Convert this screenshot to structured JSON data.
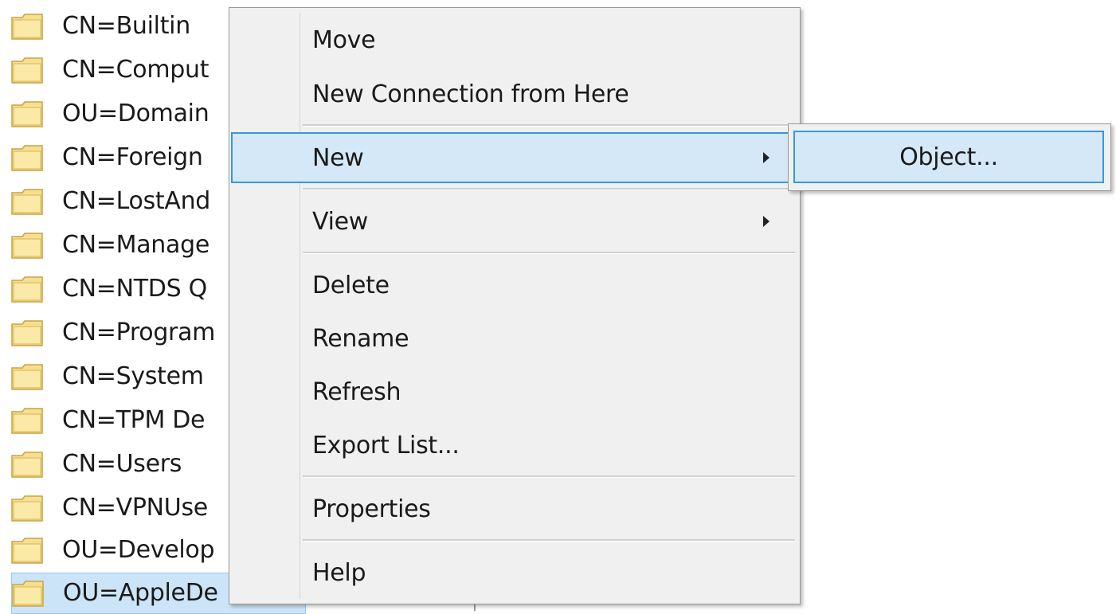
{
  "tree": {
    "items": [
      {
        "label": "CN=Builtin",
        "icon": "folder-icon"
      },
      {
        "label": "CN=Comput",
        "icon": "folder-icon"
      },
      {
        "label": "OU=Domain",
        "icon": "folder-icon"
      },
      {
        "label": "CN=Foreign",
        "icon": "folder-icon"
      },
      {
        "label": "CN=LostAnd",
        "icon": "folder-icon"
      },
      {
        "label": "CN=Manage",
        "icon": "folder-icon"
      },
      {
        "label": "CN=NTDS Q",
        "icon": "folder-icon"
      },
      {
        "label": "CN=Program",
        "icon": "folder-icon"
      },
      {
        "label": "CN=System",
        "icon": "folder-icon"
      },
      {
        "label": "CN=TPM De",
        "icon": "folder-icon"
      },
      {
        "label": "CN=Users",
        "icon": "folder-icon"
      },
      {
        "label": "CN=VPNUse",
        "icon": "folder-icon"
      },
      {
        "label": "OU=Develop",
        "icon": "folder-icon"
      },
      {
        "label": "OU=AppleDe",
        "icon": "folder-icon",
        "selected": true
      }
    ]
  },
  "context_menu": {
    "items": [
      {
        "label": "Move"
      },
      {
        "label": "New Connection from Here"
      },
      {
        "label": "New",
        "has_submenu": true,
        "highlighted": true
      },
      {
        "label": "View",
        "has_submenu": true
      },
      {
        "label": "Delete"
      },
      {
        "label": "Rename"
      },
      {
        "label": "Refresh"
      },
      {
        "label": "Export List..."
      },
      {
        "label": "Properties"
      },
      {
        "label": "Help"
      }
    ]
  },
  "submenu": {
    "items": [
      {
        "label": "Object...",
        "highlighted": true
      }
    ]
  },
  "colors": {
    "highlight_fill": "#d5e8f8",
    "highlight_border": "#3399e0",
    "menu_background": "#f0f0f0",
    "selected_row": "#cce4f7"
  }
}
